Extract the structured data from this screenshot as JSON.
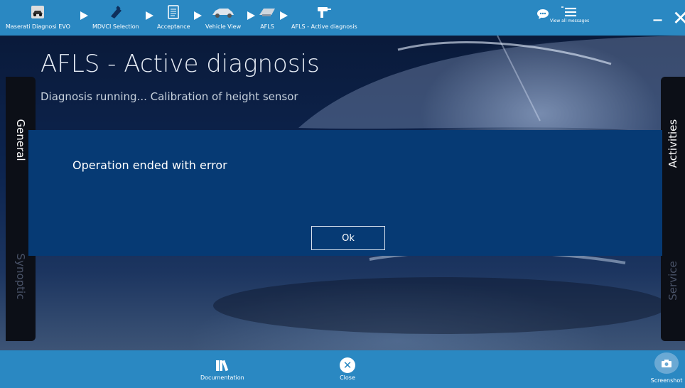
{
  "breadcrumb": [
    {
      "label": "Maserati Diagnosi EVO",
      "icon": "car-diag-icon"
    },
    {
      "label": "MDVCI Selection",
      "icon": "vci-device-icon"
    },
    {
      "label": "Acceptance",
      "icon": "document-icon"
    },
    {
      "label": "Vehicle View",
      "icon": "car-icon"
    },
    {
      "label": "AFLS",
      "icon": "ecu-icon"
    },
    {
      "label": "AFLS - Active diagnosis",
      "icon": "drill-icon"
    }
  ],
  "header_right": {
    "messages_icon": "chat-icon",
    "view_all_label": "View all messages",
    "minimize_glyph": "–",
    "close_glyph": "✕"
  },
  "page": {
    "title": "AFLS - Active diagnosis",
    "subtitle": "Diagnosis running... Calibration of height sensor"
  },
  "side_tabs": {
    "left": [
      "General",
      "Synoptic"
    ],
    "right": [
      "Activities",
      "Service"
    ]
  },
  "dialog": {
    "message": "Operation ended with error",
    "ok_label": "Ok"
  },
  "bottom_bar": {
    "documentation_label": "Documentation",
    "close_label": "Close",
    "screenshot_label": "Screenshot"
  },
  "colors": {
    "bar_blue": "#2a88c2",
    "dialog_blue": "#063a74",
    "panel_dark": "#0c0f17"
  }
}
